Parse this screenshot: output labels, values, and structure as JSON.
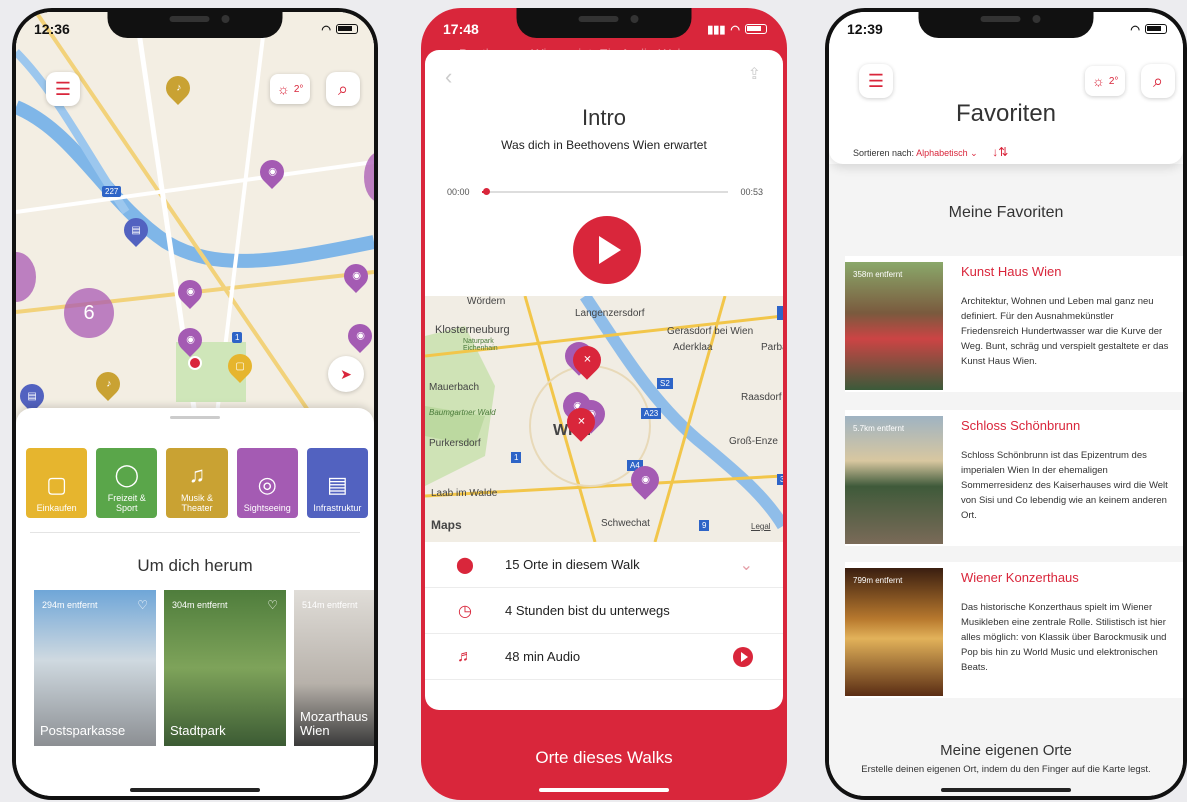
{
  "phone1": {
    "time": "12:36",
    "weather": "2°",
    "map": {
      "cluster_count": "6",
      "road_badges": [
        "227",
        "1"
      ]
    },
    "categories": [
      {
        "label": "Einkaufen",
        "color": "#e6b52e"
      },
      {
        "label": "Freizeit & Sport",
        "color": "#5aa64a"
      },
      {
        "label": "Musik & Theater",
        "color": "#c9a233"
      },
      {
        "label": "Sightseeing",
        "color": "#a45bb3"
      },
      {
        "label": "Infrastruktur",
        "color": "#5262c0"
      }
    ],
    "section_title": "Um dich herum",
    "cards": [
      {
        "distance": "294m entfernt",
        "name": "Postsparkasse"
      },
      {
        "distance": "304m entfernt",
        "name": "Stadtpark"
      },
      {
        "distance": "514m entfernt",
        "name": "Mozarthaus Wien"
      }
    ]
  },
  "phone2": {
    "time": "17:48",
    "behind_text": "Beethovens Wien zeigt. Ein Audio-Wal",
    "title": "Intro",
    "subtitle": "Was dich in Beethovens Wien erwartet",
    "time_start": "00:00",
    "time_end": "00:53",
    "progress": 0.02,
    "map_labels": [
      "Wördern",
      "Langenzersdorf",
      "Klosterneuburg",
      "Gerasdorf bei Wien",
      "Naturpark Eichenhain",
      "Aderklaa",
      "Parba",
      "Mauerbach",
      "Raasdorf",
      "Baumgartner Wald",
      "Purkersdorf",
      "Wien",
      "Groß-Enze",
      "Laab im Walde",
      "Schwechat",
      "Maps",
      "Legal"
    ],
    "map_badges": [
      "S2",
      "A23",
      "A4",
      "1",
      "9",
      "3"
    ],
    "rows": [
      {
        "icon": "location-pin",
        "text": "15 Orte in diesem Walk"
      },
      {
        "icon": "clock",
        "text": "4 Stunden bist du unterwegs"
      },
      {
        "icon": "headphones",
        "text": "48 min Audio"
      }
    ],
    "cta": "Orte dieses Walks"
  },
  "phone3": {
    "time": "12:39",
    "weather": "2°",
    "title": "Favoriten",
    "sort_label": "Sortieren nach:",
    "sort_value": "Alphabetisch",
    "section_title": "Meine Favoriten",
    "items": [
      {
        "distance": "358m entfernt",
        "name": "Kunst Haus Wien",
        "desc": "Architektur, Wohnen und Leben mal ganz neu definiert. Für den Ausnahmekünstler Friedensreich Hundertwasser war die Kurve der Weg. Bunt, schräg und verspielt gestaltete er das Kunst Haus Wien."
      },
      {
        "distance": "5.7km entfernt",
        "name": "Schloss Schönbrunn",
        "desc": "Schloss Schönbrunn ist das Epizentrum des imperialen Wien In der ehemaligen Sommerresidenz des Kaiserhauses wird die Welt von Sisi und Co lebendig wie an keinem anderen Ort."
      },
      {
        "distance": "799m entfernt",
        "name": "Wiener Konzerthaus",
        "desc": "Das historische Konzerthaus spielt im Wiener Musikleben eine zentrale Rolle. Stilistisch ist hier alles möglich: von Klassik über Barockmusik und Pop bis hin zu World Music und elektronischen Beats."
      }
    ],
    "own_title": "Meine eigenen Orte",
    "own_hint": "Erstelle deinen eigenen Ort, indem du den Finger auf die Karte legst."
  },
  "colors": {
    "accent": "#d9263b"
  }
}
